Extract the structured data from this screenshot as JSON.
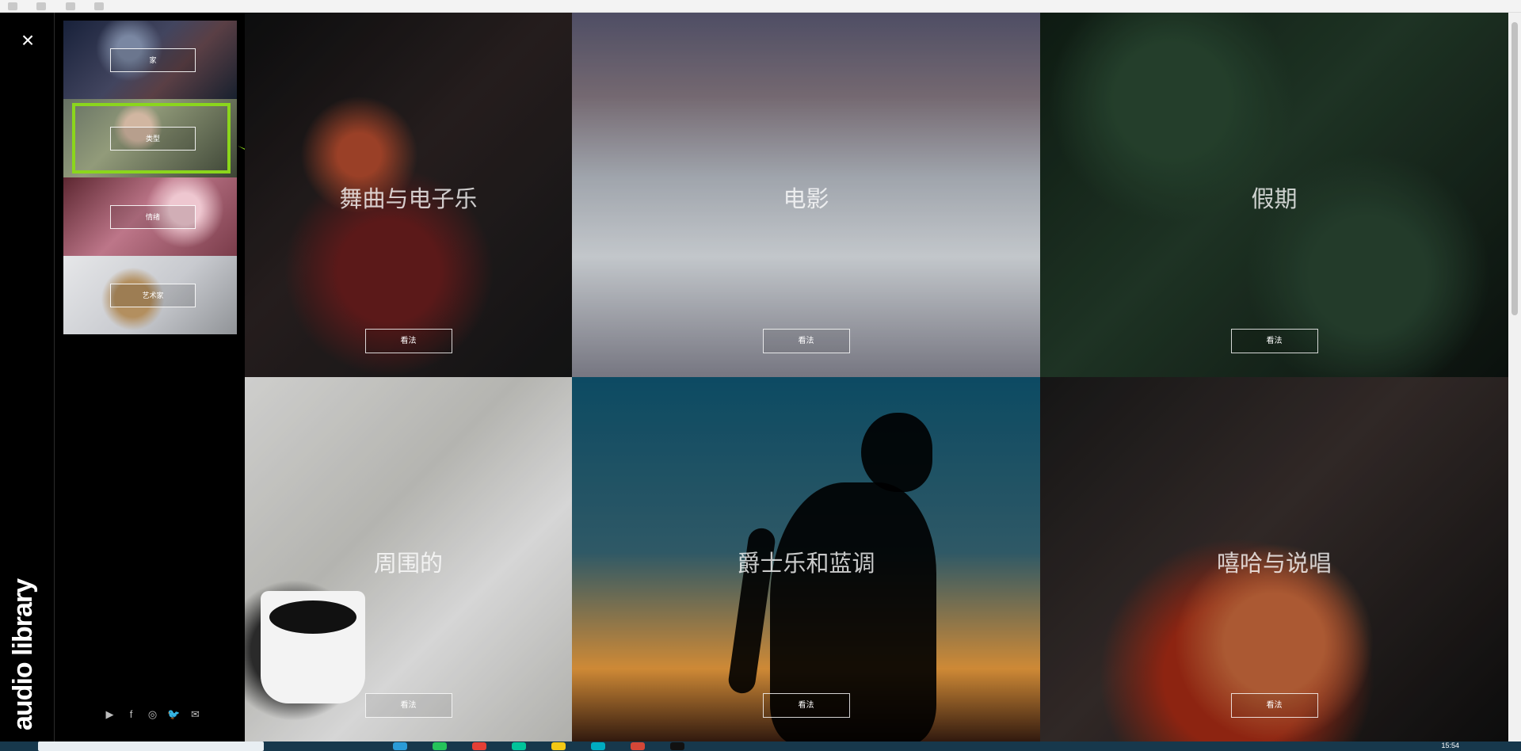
{
  "app": {
    "name": "audio library",
    "close_icon": "×"
  },
  "menu": {
    "items": [
      {
        "label": "家",
        "image": "night-sky-thumbnail"
      },
      {
        "label": "类型",
        "image": "woman-portrait-thumbnail"
      },
      {
        "label": "情绪",
        "image": "pink-hands-thumbnail"
      },
      {
        "label": "艺术家",
        "image": "sneakers-thumbnail"
      }
    ],
    "socials": [
      {
        "name": "youtube-icon",
        "symbol": "▶"
      },
      {
        "name": "facebook-icon",
        "symbol": "f"
      },
      {
        "name": "instagram-icon",
        "symbol": "◎"
      },
      {
        "name": "twitter-icon",
        "symbol": "🐦"
      },
      {
        "name": "email-icon",
        "symbol": "✉"
      }
    ]
  },
  "genres": [
    {
      "title": "舞曲与电子乐",
      "button": "看法"
    },
    {
      "title": "电影",
      "button": "看法"
    },
    {
      "title": "假期",
      "button": "看法"
    },
    {
      "title": "周围的",
      "button": "看法"
    },
    {
      "title": "爵士乐和蓝调",
      "button": "看法"
    },
    {
      "title": "嘻哈与说唱",
      "button": "看法"
    }
  ],
  "system": {
    "time": "15:54"
  },
  "colors": {
    "accent": "#8bd61c",
    "sidebar_bg": "#000000"
  }
}
